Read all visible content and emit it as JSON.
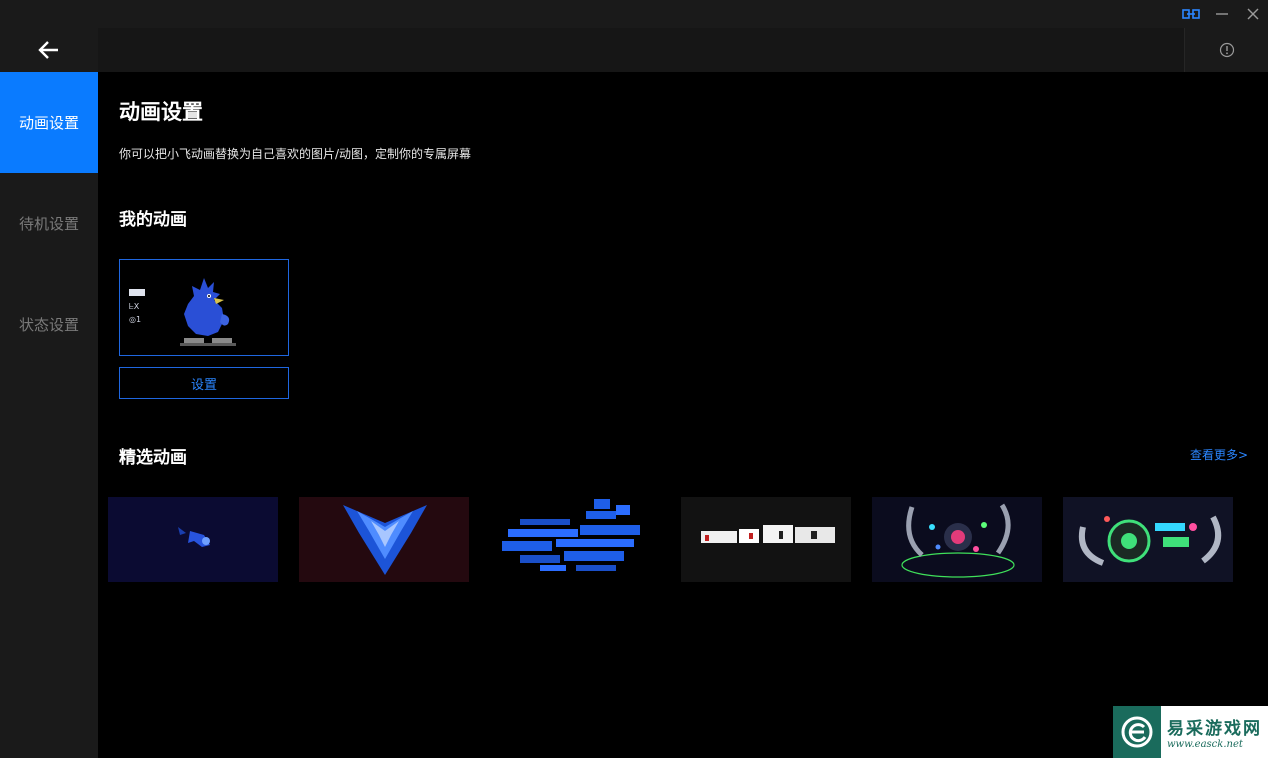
{
  "header": {
    "back_icon": "arrow-left-icon",
    "info_icon": "info-circle-icon"
  },
  "titlebar": {
    "icons": [
      "link-icon",
      "minimize-icon",
      "close-icon"
    ]
  },
  "sidebar": {
    "items": [
      {
        "label": "动画设置",
        "active": true
      },
      {
        "label": "待机设置",
        "active": false
      },
      {
        "label": "状态设置",
        "active": false
      }
    ]
  },
  "main": {
    "title": "动画设置",
    "description": "你可以把小飞动画替换为自己喜欢的图片/动图，定制你的专属屏幕",
    "my_section_title": "我的动画",
    "my_card": {
      "status_lines": [
        "ᖶX",
        "◎1"
      ]
    },
    "set_button_label": "设置",
    "featured_section_title": "精选动画",
    "more_link": "查看更多>",
    "featured_thumbnails": [
      "thumbnail-1",
      "thumbnail-2",
      "thumbnail-3",
      "thumbnail-4",
      "thumbnail-5",
      "thumbnail-6"
    ]
  },
  "watermark": {
    "cn": "易采游戏网",
    "url": "www.easck.net"
  },
  "colors": {
    "accent": "#0a7bff",
    "link": "#2b86ff",
    "sidebar_bg": "#1a1a1a",
    "main_bg": "#000000"
  }
}
